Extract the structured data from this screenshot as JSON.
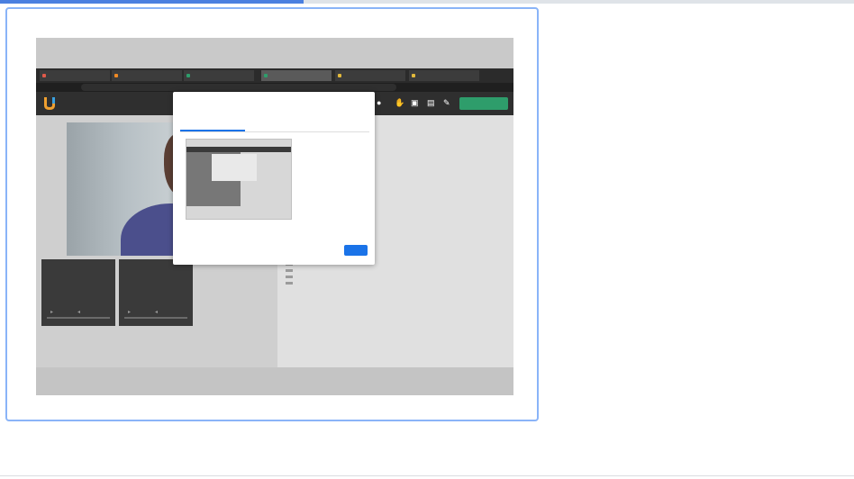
{
  "progress": {
    "fraction": 0.356,
    "color": "#4a7fe0"
  },
  "tile": {
    "selected": true,
    "border_color": "#8ab4f8"
  },
  "shared_screen": {
    "browser_tabs": [
      {
        "label": "",
        "icon_color": "#e05a4a"
      },
      {
        "label": "",
        "icon_color": "#f08a24"
      },
      {
        "label": "",
        "icon_color": "#2e9d6b"
      },
      {
        "label": "",
        "icon_color": "#2e9d6b",
        "active": true
      },
      {
        "label": "",
        "icon_color": "#e2b93b"
      },
      {
        "label": "",
        "icon_color": "#e2b93b"
      }
    ],
    "address": "",
    "leave_button_label": "",
    "modal": {
      "title": "",
      "description": "",
      "tabs": [
        "",
        "",
        ""
      ],
      "cancel_label": "",
      "share_label": ""
    }
  }
}
